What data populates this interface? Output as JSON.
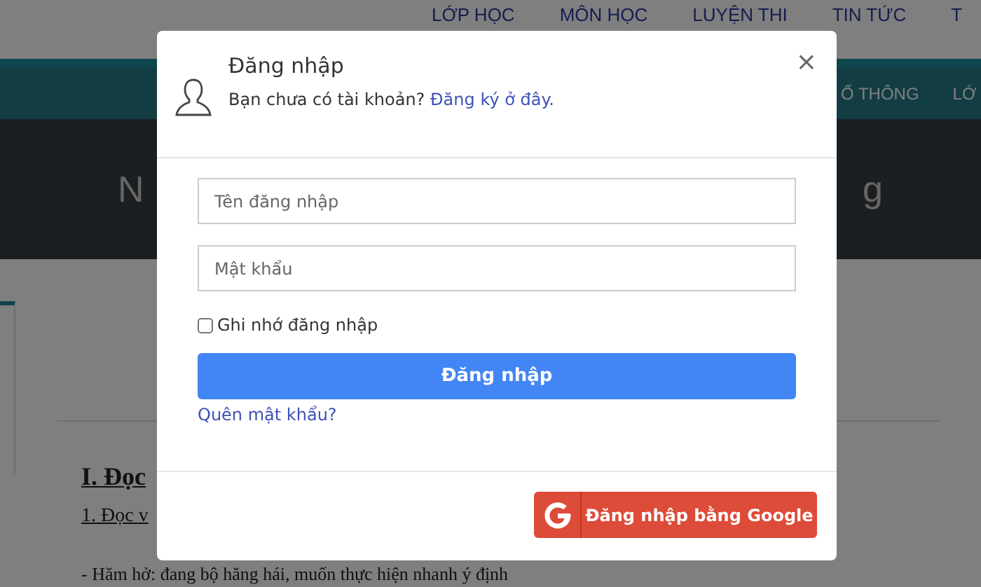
{
  "page": {
    "nav": [
      "LỚP HỌC",
      "MÔN HỌC",
      "LUYỆN THI",
      "TIN TỨC",
      "T"
    ],
    "subnav": [
      "Ổ THÔNG",
      "LỚ"
    ],
    "banner": {
      "left": "N",
      "right": "g"
    },
    "heading": "I. Đọc",
    "subheading": "1. Đọc v",
    "line": "- Hăm hở: đang bộ hăng hái, muốn thực hiện nhanh ý định"
  },
  "modal": {
    "title": "Đăng nhập",
    "subtitle": "Bạn chưa có tài khoản?",
    "register_link": "Đăng ký ở đây.",
    "close": "×",
    "fields": [
      {
        "placeholder": "Tên đăng nhập"
      },
      {
        "placeholder": "Mật khẩu"
      }
    ],
    "remember": {
      "label": "Ghi nhớ đăng nhập",
      "checked": false
    },
    "submit": "Đăng nhập",
    "forgot": "Quên mật khẩu?",
    "google": "Đăng nhập bằng Google"
  }
}
